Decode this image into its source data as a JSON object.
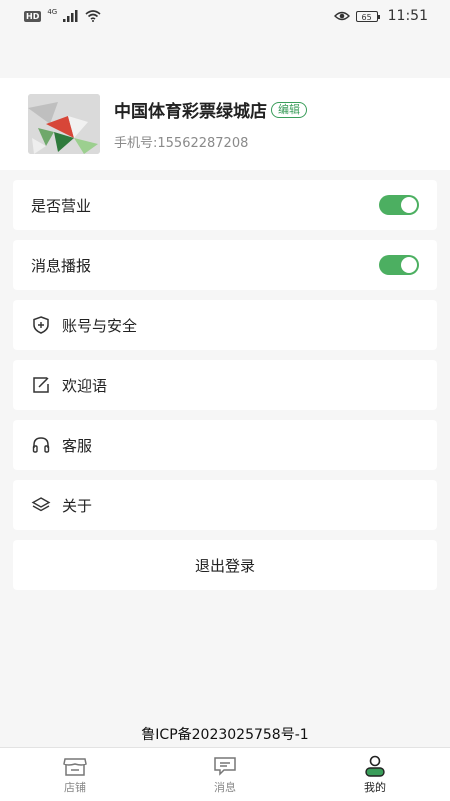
{
  "status_bar": {
    "hd": "HD",
    "network": "4G",
    "battery": "65",
    "time": "11:51"
  },
  "profile": {
    "store_name": "中国体育彩票绿城店",
    "edit_label": "编辑",
    "phone": "手机号:15562287208"
  },
  "settings": {
    "business_open_label": "是否营业",
    "business_open_on": true,
    "message_broadcast_label": "消息播报",
    "message_broadcast_on": true,
    "account_security_label": "账号与安全",
    "welcome_label": "欢迎语",
    "customer_service_label": "客服",
    "about_label": "关于",
    "logout_label": "退出登录"
  },
  "icp": "鲁ICP备2023025758号-1",
  "tab_bar": {
    "tabs": [
      {
        "label": "店铺",
        "icon": "store-icon"
      },
      {
        "label": "消息",
        "icon": "message-icon"
      },
      {
        "label": "我的",
        "icon": "profile-icon"
      }
    ],
    "active_index": 2
  },
  "colors": {
    "accent": "#4caf61",
    "edit_badge": "#3a9d5a",
    "background": "#f6f6f6"
  }
}
